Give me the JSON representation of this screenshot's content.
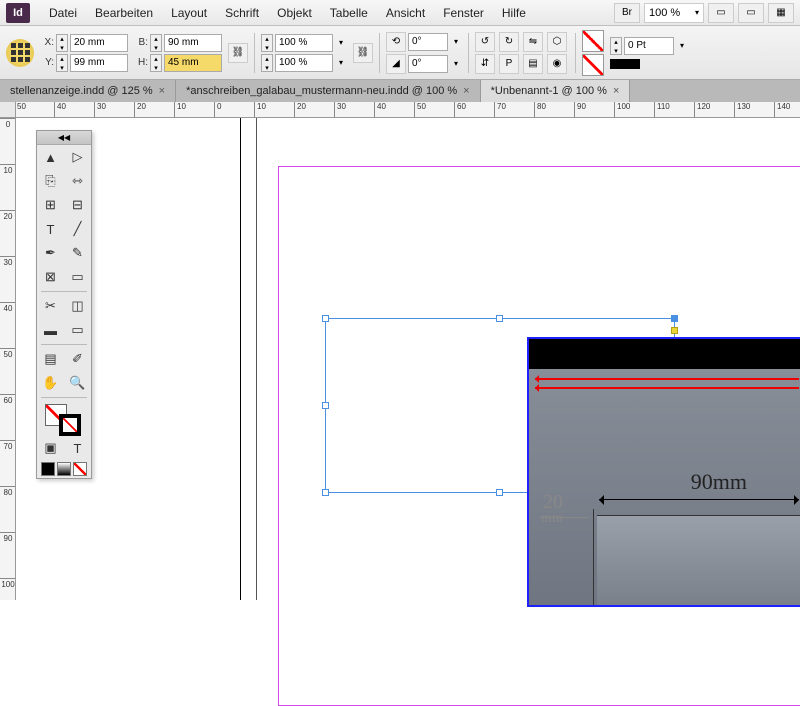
{
  "menu": {
    "items": [
      "Datei",
      "Bearbeiten",
      "Layout",
      "Schrift",
      "Objekt",
      "Tabelle",
      "Ansicht",
      "Fenster",
      "Hilfe"
    ],
    "br_label": "Br",
    "zoom": "100 %"
  },
  "control": {
    "x_label": "X:",
    "x_value": "20 mm",
    "y_label": "Y:",
    "y_value": "99 mm",
    "w_label": "B:",
    "w_value": "90 mm",
    "h_label": "H:",
    "h_value": "45 mm",
    "scale_x": "100 %",
    "scale_y": "100 %",
    "rotate": "0°",
    "shear": "0°",
    "stroke_pt": "0 Pt"
  },
  "tabs": [
    {
      "label": "stellenanzeige.indd @ 125 %",
      "active": false
    },
    {
      "label": "*anschreiben_galabau_mustermann-neu.indd @ 100 %",
      "active": false
    },
    {
      "label": "*Unbenannt-1 @ 100 %",
      "active": true
    }
  ],
  "ruler_h": [
    "50",
    "40",
    "30",
    "20",
    "10",
    "0",
    "10",
    "20",
    "30",
    "40",
    "50",
    "60",
    "70",
    "80",
    "90",
    "100",
    "110",
    "120",
    "130",
    "140"
  ],
  "ruler_v": [
    "0",
    "10",
    "20",
    "30",
    "40",
    "50",
    "60",
    "70",
    "80",
    "90",
    "100"
  ],
  "dims": {
    "right": "90mm",
    "left": "20",
    "left_unit": "mm"
  },
  "tools_header": "◀◀"
}
